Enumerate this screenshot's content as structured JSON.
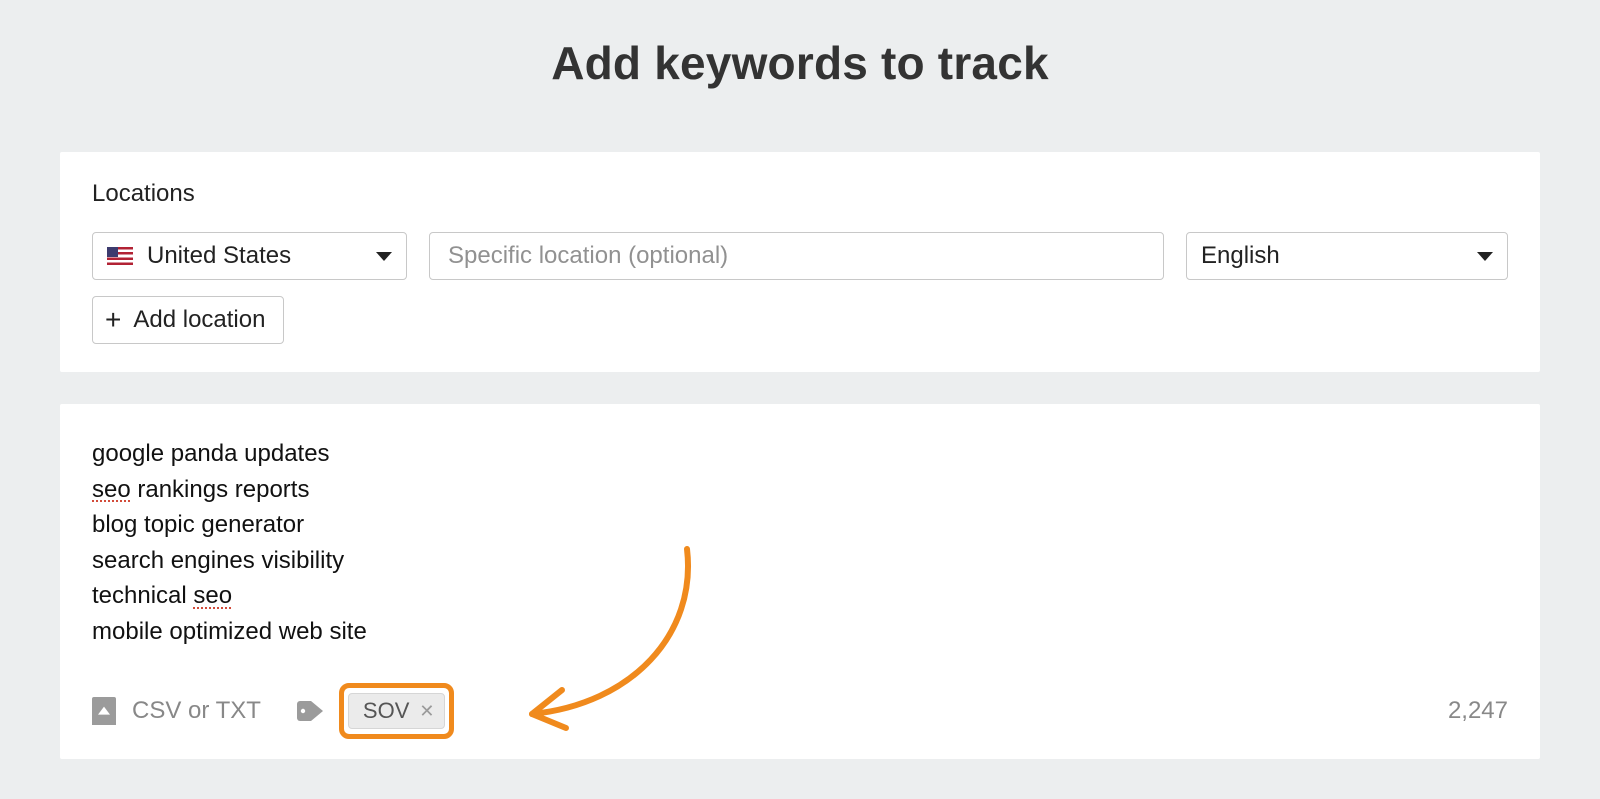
{
  "title": "Add keywords to track",
  "locations": {
    "label": "Locations",
    "country": "United States",
    "specific_placeholder": "Specific location (optional)",
    "language": "English",
    "add_location_label": "Add location"
  },
  "keywords": {
    "items": [
      {
        "pre": "",
        "mis": "",
        "post": "google panda updates"
      },
      {
        "pre": "",
        "mis": "seo",
        "post": " rankings reports"
      },
      {
        "pre": "",
        "mis": "",
        "post": "blog topic generator"
      },
      {
        "pre": "",
        "mis": "",
        "post": "search engines visibility"
      },
      {
        "pre": "technical ",
        "mis": "seo",
        "post": ""
      },
      {
        "pre": "",
        "mis": "",
        "post": "mobile optimized web site"
      }
    ],
    "upload_label": "CSV or TXT",
    "tag": "SOV",
    "count": "2,247"
  }
}
